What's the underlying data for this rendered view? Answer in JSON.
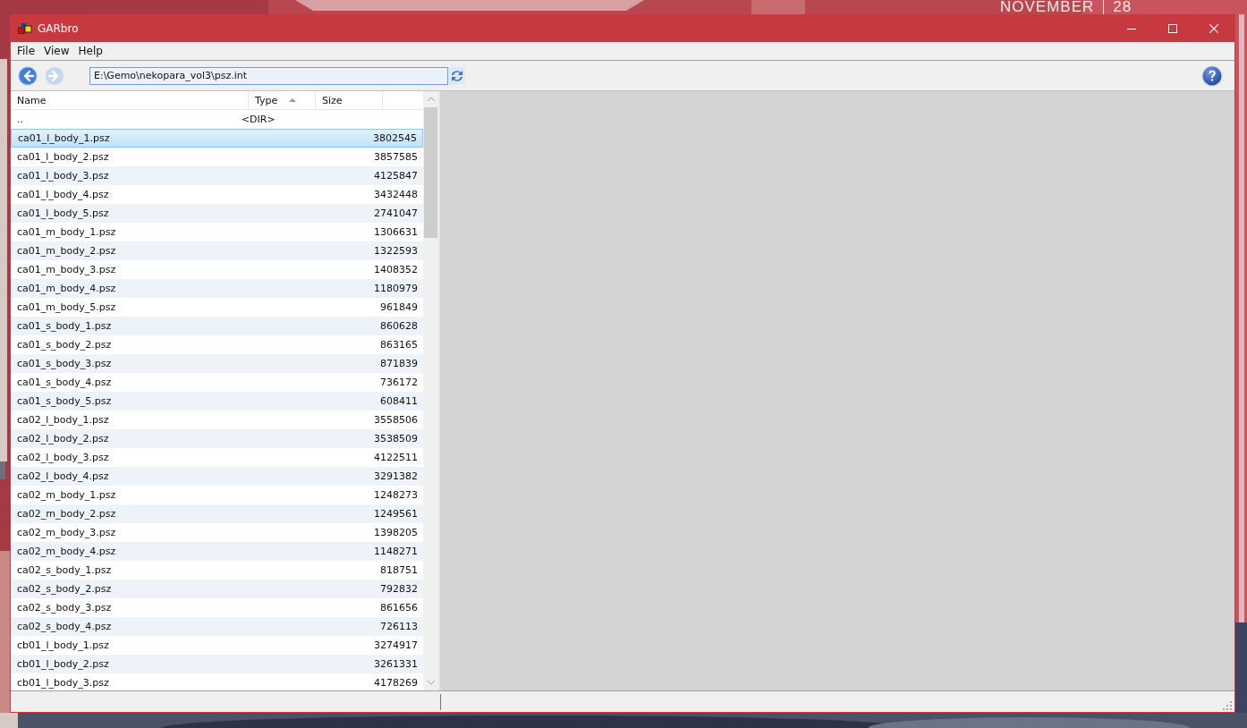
{
  "desktop": {
    "clock_month": "NOVEMBER",
    "clock_day": "28"
  },
  "window": {
    "title": "GARbro"
  },
  "menu": [
    "File",
    "View",
    "Help"
  ],
  "toolbar": {
    "back_disabled": false,
    "forward_disabled": true,
    "path": "E:\\Gemo\\nekopara_vol3\\psz.int"
  },
  "table": {
    "columns": [
      {
        "label": "Name",
        "sorted": false
      },
      {
        "label": "Type",
        "sorted": true
      },
      {
        "label": "Size",
        "sorted": false
      }
    ],
    "rows": [
      {
        "name": "..",
        "type": "<DIR>",
        "selected": false
      },
      {
        "name": "ca01_l_body_1.psz",
        "size": "3802545",
        "selected": true
      },
      {
        "name": "ca01_l_body_2.psz",
        "size": "3857585",
        "selected": false
      },
      {
        "name": "ca01_l_body_3.psz",
        "size": "4125847",
        "selected": false
      },
      {
        "name": "ca01_l_body_4.psz",
        "size": "3432448",
        "selected": false
      },
      {
        "name": "ca01_l_body_5.psz",
        "size": "2741047",
        "selected": false
      },
      {
        "name": "ca01_m_body_1.psz",
        "size": "1306631",
        "selected": false
      },
      {
        "name": "ca01_m_body_2.psz",
        "size": "1322593",
        "selected": false
      },
      {
        "name": "ca01_m_body_3.psz",
        "size": "1408352",
        "selected": false
      },
      {
        "name": "ca01_m_body_4.psz",
        "size": "1180979",
        "selected": false
      },
      {
        "name": "ca01_m_body_5.psz",
        "size": "961849",
        "selected": false
      },
      {
        "name": "ca01_s_body_1.psz",
        "size": "860628",
        "selected": false
      },
      {
        "name": "ca01_s_body_2.psz",
        "size": "863165",
        "selected": false
      },
      {
        "name": "ca01_s_body_3.psz",
        "size": "871839",
        "selected": false
      },
      {
        "name": "ca01_s_body_4.psz",
        "size": "736172",
        "selected": false
      },
      {
        "name": "ca01_s_body_5.psz",
        "size": "608411",
        "selected": false
      },
      {
        "name": "ca02_l_body_1.psz",
        "size": "3558506",
        "selected": false
      },
      {
        "name": "ca02_l_body_2.psz",
        "size": "3538509",
        "selected": false
      },
      {
        "name": "ca02_l_body_3.psz",
        "size": "4122511",
        "selected": false
      },
      {
        "name": "ca02_l_body_4.psz",
        "size": "3291382",
        "selected": false
      },
      {
        "name": "ca02_m_body_1.psz",
        "size": "1248273",
        "selected": false
      },
      {
        "name": "ca02_m_body_2.psz",
        "size": "1249561",
        "selected": false
      },
      {
        "name": "ca02_m_body_3.psz",
        "size": "1398205",
        "selected": false
      },
      {
        "name": "ca02_m_body_4.psz",
        "size": "1148271",
        "selected": false
      },
      {
        "name": "ca02_s_body_1.psz",
        "size": "818751",
        "selected": false
      },
      {
        "name": "ca02_s_body_2.psz",
        "size": "792832",
        "selected": false
      },
      {
        "name": "ca02_s_body_3.psz",
        "size": "861656",
        "selected": false
      },
      {
        "name": "ca02_s_body_4.psz",
        "size": "726113",
        "selected": false
      },
      {
        "name": "cb01_l_body_1.psz",
        "size": "3274917",
        "selected": false
      },
      {
        "name": "cb01_l_body_2.psz",
        "size": "3261331",
        "selected": false
      },
      {
        "name": "cb01_l_body_3.psz",
        "size": "4178269",
        "selected": false
      }
    ]
  }
}
